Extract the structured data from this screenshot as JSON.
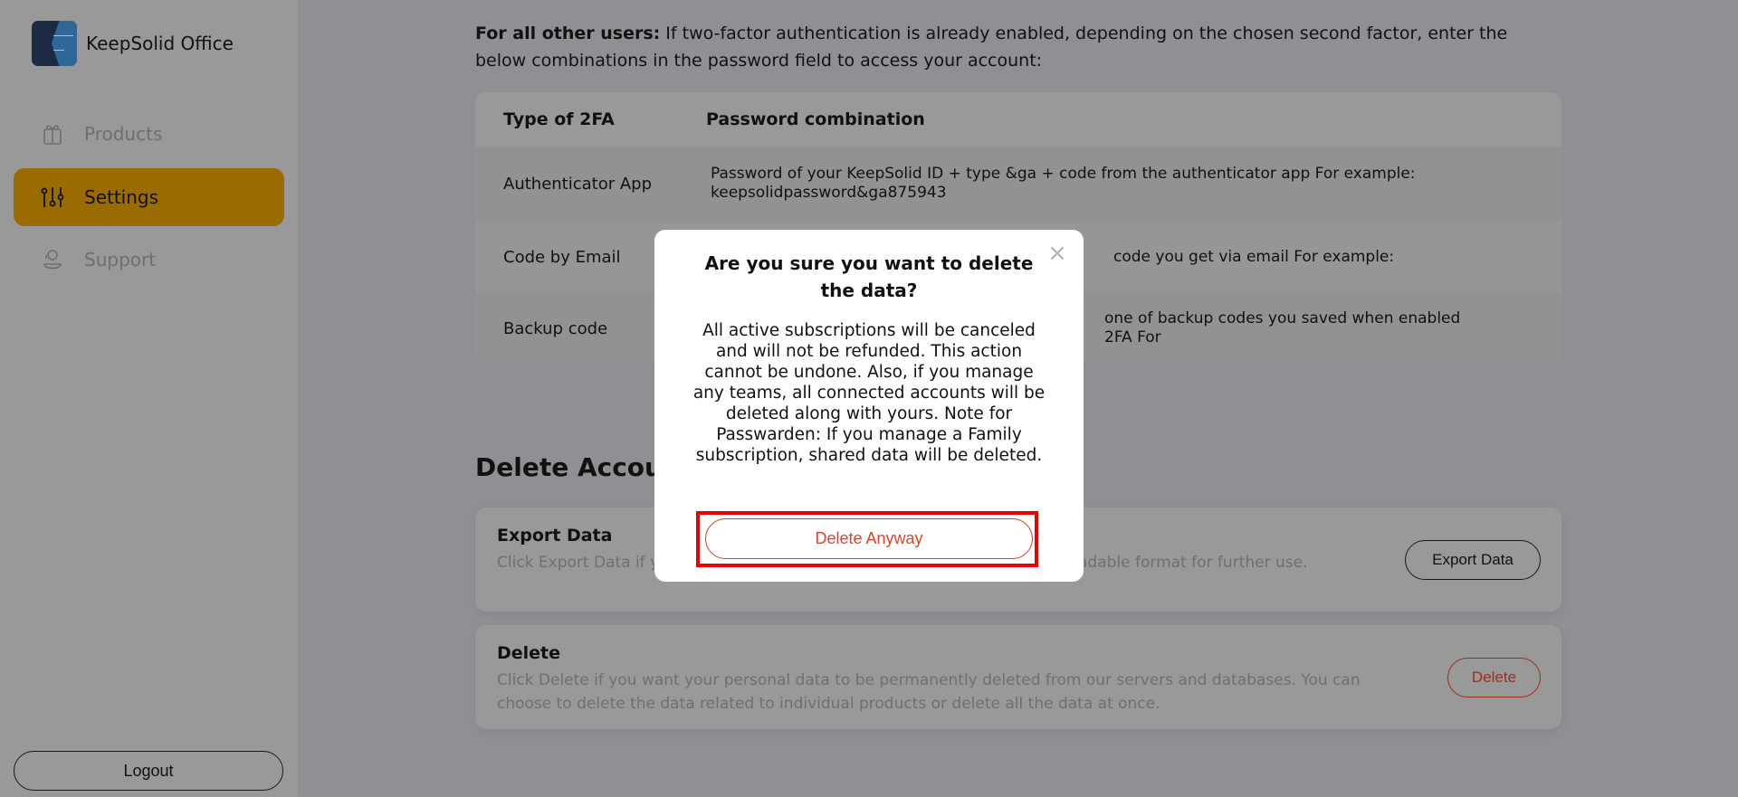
{
  "app": {
    "name": "KeepSolid Office",
    "logo_icon": "keepsolid-logo-icon"
  },
  "sidebar": {
    "items": [
      {
        "label": "Products",
        "icon": "gift-bag-icon",
        "active": false
      },
      {
        "label": "Settings",
        "icon": "sliders-icon",
        "active": true
      },
      {
        "label": "Support",
        "icon": "support-agent-icon",
        "active": false
      }
    ],
    "logout_label": "Logout",
    "active_color": "#9a6c00"
  },
  "main": {
    "intro_bold": "For all other users:",
    "intro_text": " If two-factor authentication is already enabled, depending on the chosen second factor, enter the below combinations in the password field to access your account:",
    "tfa_table": {
      "headers": [
        "Type of 2FA",
        "Password combination"
      ],
      "rows": [
        {
          "type": "Authenticator App",
          "combination": "Password of your KeepSolid ID + type &ga + code from the authenticator app For example: keepsolidpassword&ga875943"
        },
        {
          "type": "Code by Email",
          "combination": "code you get via email For example:"
        },
        {
          "type": "Backup code",
          "combination": "one of backup codes you saved when enabled 2FA For"
        }
      ]
    },
    "delete_section": {
      "title": "Delete Account",
      "export_card": {
        "title": "Export Data",
        "description": "Click Export Data if you want to receive your personal data in a machine-readable format for further use.",
        "button_label": "Export Data"
      },
      "delete_card": {
        "title": "Delete",
        "description": "Click Delete if you want your personal data to be permanently deleted from our servers and databases. You can choose to delete the data related to individual products or delete all the data at once.",
        "button_label": "Delete"
      }
    }
  },
  "modal": {
    "title": "Are you sure you want to delete the data?",
    "body": "All active subscriptions will be canceled and will not be refunded. This action cannot be undone. Also, if you manage any teams, all connected accounts will be deleted along with yours. Note for Passwarden: If you manage a Family subscription, shared data will be deleted.",
    "confirm_label": "Delete Anyway",
    "close_icon": "close-icon",
    "danger_color": "#d9432f",
    "highlight_color": "#ee0000"
  }
}
